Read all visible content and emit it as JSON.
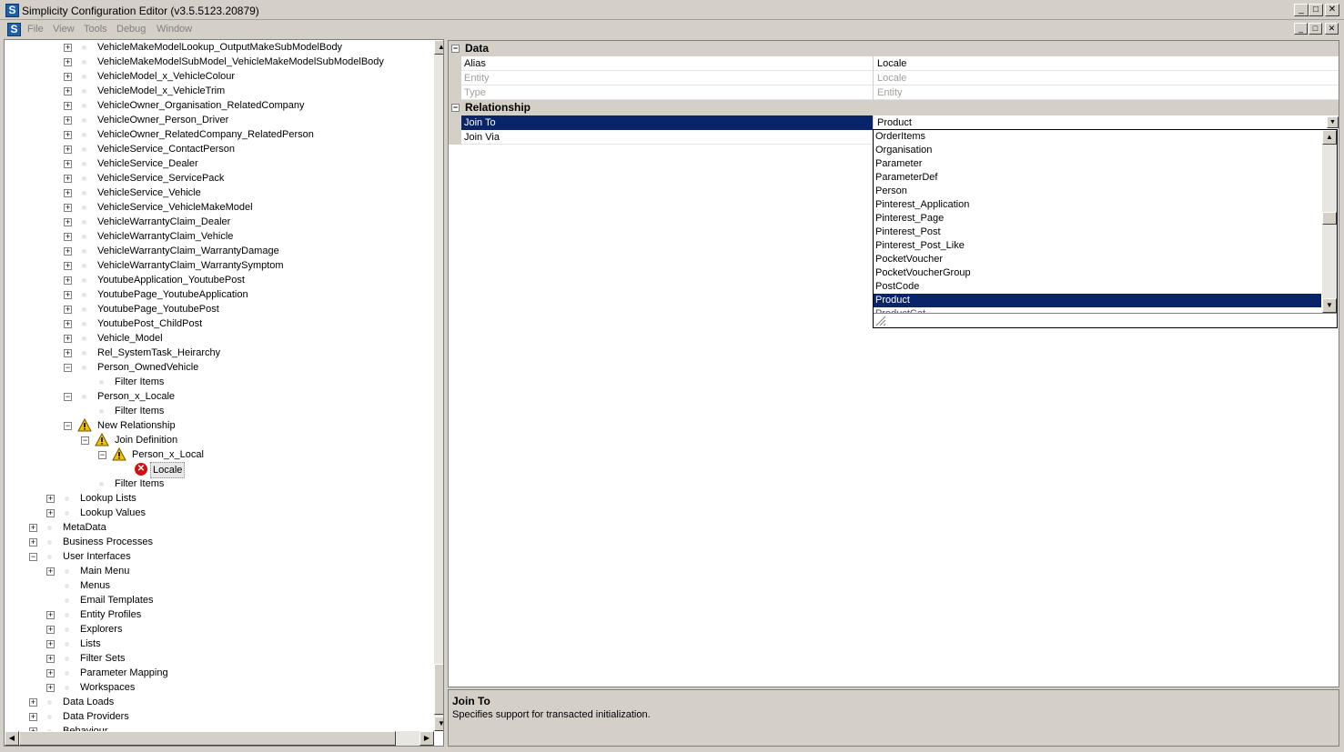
{
  "window": {
    "title": "Simplicity Configuration Editor (v3.5.5123.20879)",
    "app_icon_letter": "S",
    "minimize": "_",
    "maximize": "□",
    "close": "✕"
  },
  "menu": {
    "items": [
      "File",
      "View",
      "Tools",
      "Debug",
      "Window"
    ]
  },
  "tree": {
    "rows": [
      {
        "label": "VehicleMakeModelLookup_OutputMakeSubModelBody",
        "level": 3,
        "expander": "+"
      },
      {
        "label": "VehicleMakeModelSubModel_VehicleMakeModelSubModelBody",
        "level": 3,
        "expander": "+"
      },
      {
        "label": "VehicleModel_x_VehicleColour",
        "level": 3,
        "expander": "+"
      },
      {
        "label": "VehicleModel_x_VehicleTrim",
        "level": 3,
        "expander": "+"
      },
      {
        "label": "VehicleOwner_Organisation_RelatedCompany",
        "level": 3,
        "expander": "+"
      },
      {
        "label": "VehicleOwner_Person_Driver",
        "level": 3,
        "expander": "+"
      },
      {
        "label": "VehicleOwner_RelatedCompany_RelatedPerson",
        "level": 3,
        "expander": "+"
      },
      {
        "label": "VehicleService_ContactPerson",
        "level": 3,
        "expander": "+"
      },
      {
        "label": "VehicleService_Dealer",
        "level": 3,
        "expander": "+"
      },
      {
        "label": "VehicleService_ServicePack",
        "level": 3,
        "expander": "+"
      },
      {
        "label": "VehicleService_Vehicle",
        "level": 3,
        "expander": "+"
      },
      {
        "label": "VehicleService_VehicleMakeModel",
        "level": 3,
        "expander": "+"
      },
      {
        "label": "VehicleWarrantyClaim_Dealer",
        "level": 3,
        "expander": "+"
      },
      {
        "label": "VehicleWarrantyClaim_Vehicle",
        "level": 3,
        "expander": "+"
      },
      {
        "label": "VehicleWarrantyClaim_WarrantyDamage",
        "level": 3,
        "expander": "+"
      },
      {
        "label": "VehicleWarrantyClaim_WarrantySymptom",
        "level": 3,
        "expander": "+"
      },
      {
        "label": "YoutubeApplication_YoutubePost",
        "level": 3,
        "expander": "+"
      },
      {
        "label": "YoutubePage_YoutubeApplication",
        "level": 3,
        "expander": "+"
      },
      {
        "label": "YoutubePage_YoutubePost",
        "level": 3,
        "expander": "+"
      },
      {
        "label": "YoutubePost_ChildPost",
        "level": 3,
        "expander": "+"
      },
      {
        "label": "Vehicle_Model",
        "level": 3,
        "expander": "+"
      },
      {
        "label": "Rel_SystemTask_Heirarchy",
        "level": 3,
        "expander": "+"
      },
      {
        "label": "Person_OwnedVehicle",
        "level": 3,
        "expander": "−"
      },
      {
        "label": "Filter Items",
        "level": 4,
        "expander": ""
      },
      {
        "label": "Person_x_Locale",
        "level": 3,
        "expander": "−"
      },
      {
        "label": "Filter Items",
        "level": 4,
        "expander": ""
      },
      {
        "label": "New Relationship",
        "level": 3,
        "expander": "−",
        "icon": "warning"
      },
      {
        "label": "Join Definition",
        "level": 4,
        "expander": "−",
        "icon": "warning"
      },
      {
        "label": "Person_x_Local",
        "level": 5,
        "expander": "−",
        "icon": "warning"
      },
      {
        "label": "Locale",
        "level": 6,
        "expander": "",
        "icon": "error",
        "selected": true
      },
      {
        "label": "Filter Items",
        "level": 4,
        "expander": ""
      },
      {
        "label": "Lookup Lists",
        "level": 2,
        "expander": "+"
      },
      {
        "label": "Lookup Values",
        "level": 2,
        "expander": "+"
      },
      {
        "label": "MetaData",
        "level": 1,
        "expander": "+"
      },
      {
        "label": "Business Processes",
        "level": 1,
        "expander": "+"
      },
      {
        "label": "User Interfaces",
        "level": 1,
        "expander": "−"
      },
      {
        "label": "Main Menu",
        "level": 2,
        "expander": "+"
      },
      {
        "label": "Menus",
        "level": 2,
        "expander": ""
      },
      {
        "label": "Email Templates",
        "level": 2,
        "expander": ""
      },
      {
        "label": "Entity Profiles",
        "level": 2,
        "expander": "+"
      },
      {
        "label": "Explorers",
        "level": 2,
        "expander": "+"
      },
      {
        "label": "Lists",
        "level": 2,
        "expander": "+"
      },
      {
        "label": "Filter Sets",
        "level": 2,
        "expander": "+"
      },
      {
        "label": "Parameter Mapping",
        "level": 2,
        "expander": "+"
      },
      {
        "label": "Workspaces",
        "level": 2,
        "expander": "+"
      },
      {
        "label": "Data Loads",
        "level": 1,
        "expander": "+"
      },
      {
        "label": "Data Providers",
        "level": 1,
        "expander": "+"
      },
      {
        "label": "Behaviour",
        "level": 1,
        "expander": "+"
      }
    ]
  },
  "propertygrid": {
    "categories": [
      {
        "name": "Data",
        "expander": "−",
        "props": [
          {
            "name": "Alias",
            "value": "Locale",
            "disabled": false
          },
          {
            "name": "Entity",
            "value": "Locale",
            "disabled": true
          },
          {
            "name": "Type",
            "value": "Entity",
            "disabled": true
          }
        ]
      },
      {
        "name": "Relationship",
        "expander": "−",
        "props": [
          {
            "name": "Join To",
            "value": "Product",
            "disabled": false,
            "selected": true,
            "dropdown": true
          },
          {
            "name": "Join Via",
            "value": "",
            "disabled": false
          }
        ]
      }
    ]
  },
  "dropdown": {
    "items": [
      "OrderItems",
      "Organisation",
      "Parameter",
      "ParameterDef",
      "Person",
      "Pinterest_Application",
      "Pinterest_Page",
      "Pinterest_Post",
      "Pinterest_Post_Like",
      "PocketVoucher",
      "PocketVoucherGroup",
      "PostCode",
      "Product"
    ],
    "selected": "Product",
    "partial_next": "ProductCat..."
  },
  "help": {
    "title": "Join To",
    "description": "Specifies support for transacted initialization."
  },
  "colors": {
    "selection": "#0a246a",
    "chrome": "#d4d0c8",
    "disabled_text": "#a0a0a0",
    "error": "#d01010",
    "warning": "#f2c200"
  }
}
